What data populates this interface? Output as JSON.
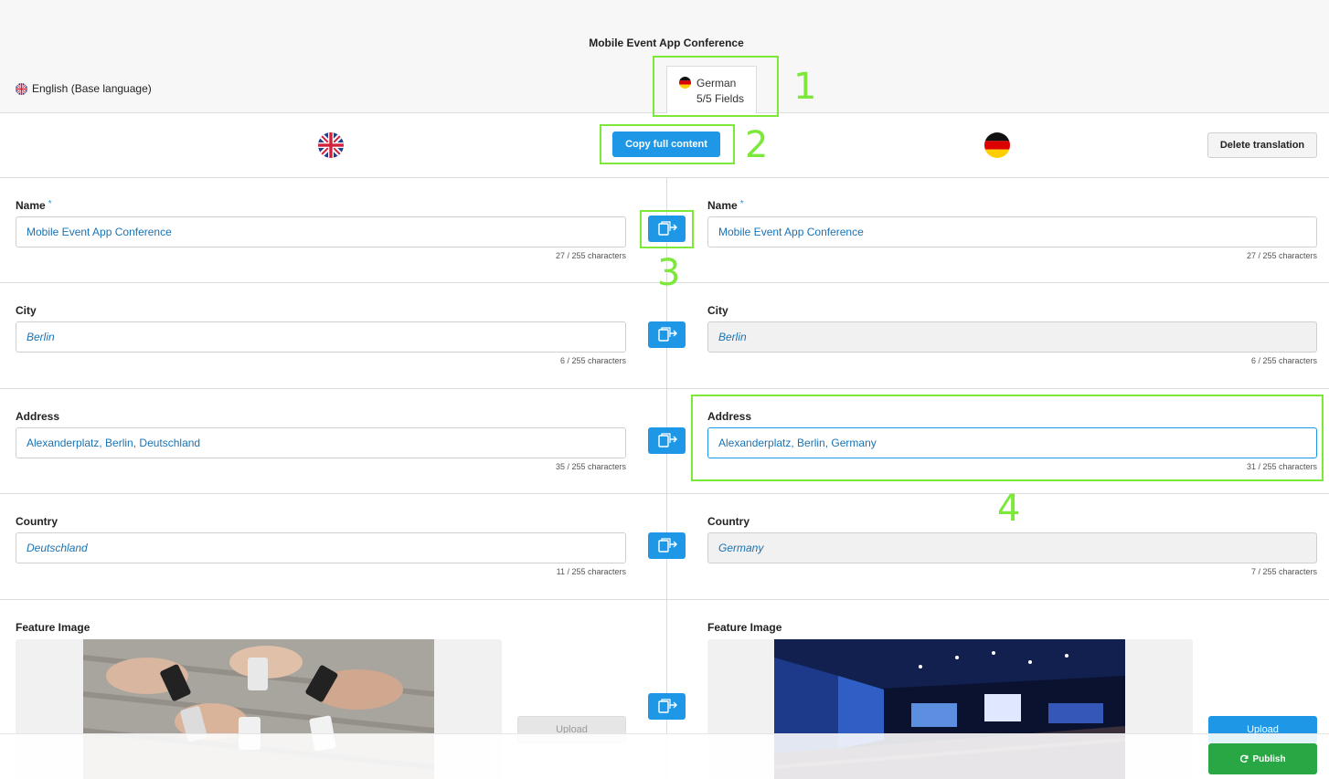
{
  "header": {
    "title": "Mobile Event App Conference",
    "base_language": "English (Base language)",
    "tab": {
      "language": "German",
      "fields": "5/5 Fields"
    }
  },
  "toolbar": {
    "copy_full_label": "Copy full content",
    "delete_label": "Delete translation"
  },
  "fields": [
    {
      "label": "Name",
      "required": "*",
      "source": "Mobile Event App Conference",
      "source_count": "27 / 255 characters",
      "target": "Mobile Event App Conference",
      "target_count": "27 / 255 characters"
    },
    {
      "label": "City",
      "required": "",
      "source": "Berlin",
      "source_count": "6 / 255 characters",
      "target": "Berlin",
      "target_count": "6 / 255 characters"
    },
    {
      "label": "Address",
      "required": "",
      "source": "Alexanderplatz, Berlin, Deutschland",
      "source_count": "35 / 255 characters",
      "target": "Alexanderplatz, Berlin, Germany",
      "target_count": "31 / 255 characters"
    },
    {
      "label": "Country",
      "required": "",
      "source": "Deutschland",
      "source_count": "11 / 255 characters",
      "target": "Germany",
      "target_count": "7 / 255 characters"
    }
  ],
  "feature_image": {
    "label": "Feature Image",
    "upload_label": "Upload"
  },
  "footer": {
    "publish_label": "Publish"
  },
  "annotations": [
    "1",
    "2",
    "3",
    "4"
  ],
  "colors": {
    "primary": "#1e98e6",
    "success": "#29a745",
    "annotation": "#7be83a"
  }
}
